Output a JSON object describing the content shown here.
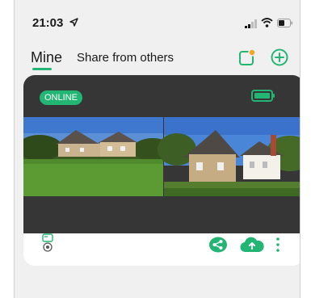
{
  "status_bar": {
    "time": "21:03"
  },
  "header": {
    "tabs": [
      {
        "label": "Mine",
        "active": true
      },
      {
        "label": "Share from others",
        "active": false
      }
    ]
  },
  "device": {
    "status": "ONLINE",
    "battery": "full"
  },
  "colors": {
    "accent": "#22b573",
    "video_bg": "#363636",
    "card_bg": "#ffffff",
    "page_bg": "#f0f0f0",
    "notify_dot": "#f5a623"
  },
  "icons": [
    "location-arrow-icon",
    "signal-icon",
    "wifi-icon",
    "battery-icon",
    "notification-icon",
    "add-icon",
    "battery-full-icon",
    "camera-icon",
    "share-icon",
    "cloud-icon",
    "more-icon"
  ]
}
